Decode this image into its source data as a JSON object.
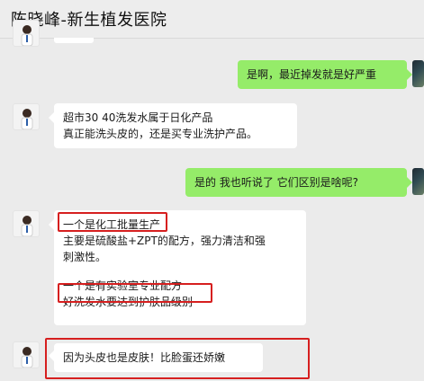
{
  "header": {
    "title": "陈晓峰-新生植发医院"
  },
  "messages": [
    {
      "side": "right",
      "lines": [
        "是啊，最近掉发就是好严重"
      ]
    },
    {
      "side": "left",
      "lines": [
        "超市30  40洗发水属于日化产品",
        "真正能洗头皮的，还是买专业洗护产品。"
      ]
    },
    {
      "side": "right",
      "lines": [
        "是的  我也听说了  它们区别是啥呢?"
      ]
    },
    {
      "side": "left",
      "lines": [
        "一个是化工批量生产",
        "主要是硫酸盐+ZPT的配方，强力清洁和强",
        "刺激性。",
        "一个是有实验室专业配方",
        "好洗发水要达到护肤品级别"
      ]
    },
    {
      "side": "left",
      "lines": [
        "因为头皮也是皮肤！比脸蛋还娇嫩"
      ]
    }
  ],
  "colors": {
    "sent_bubble": "#95ec69",
    "received_bubble": "#ffffff",
    "highlight_border": "#d61f1f",
    "background": "#ebebeb"
  }
}
